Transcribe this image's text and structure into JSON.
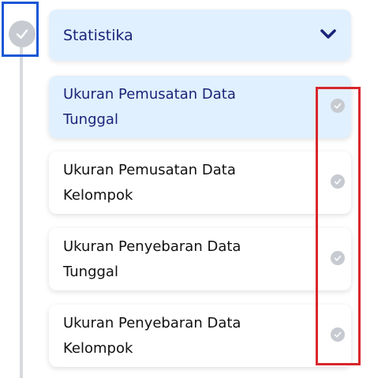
{
  "section": {
    "title": "Statistika",
    "expand_icon": "chevron-down-icon",
    "status_icon": "check-circle-icon"
  },
  "lessons": [
    {
      "line1": "Ukuran Pemusatan Data",
      "line2": "Tunggal",
      "active": true
    },
    {
      "line1": "Ukuran Pemusatan Data",
      "line2": "Kelompok",
      "active": false
    },
    {
      "line1": "Ukuran Penyebaran Data",
      "line2": "Tunggal",
      "active": false
    },
    {
      "line1": "Ukuran Penyebaran Data",
      "line2": "Kelompok",
      "active": false
    }
  ],
  "colors": {
    "active_bg": "#e1f0fe",
    "active_text": "#1a2478",
    "check_gray": "#c7cbd1",
    "highlight_blue": "#1757d6",
    "highlight_red": "#d8262b"
  }
}
